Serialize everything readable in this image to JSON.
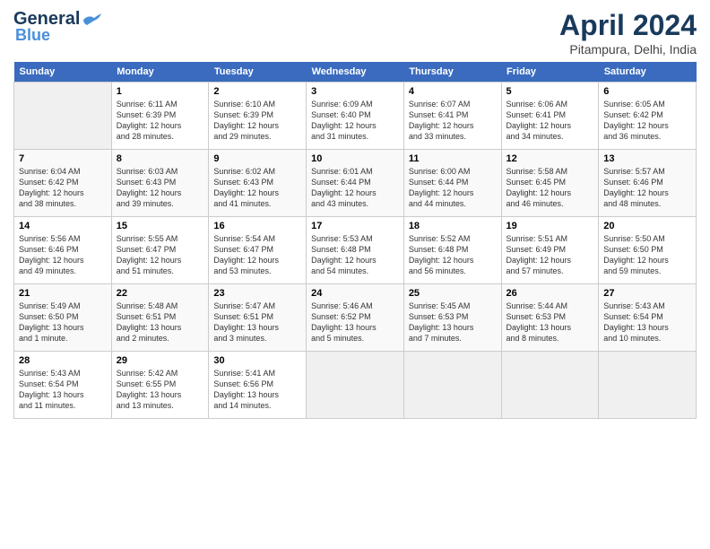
{
  "header": {
    "logo_line1": "General",
    "logo_line2": "Blue",
    "title": "April 2024",
    "subtitle": "Pitampura, Delhi, India"
  },
  "weekdays": [
    "Sunday",
    "Monday",
    "Tuesday",
    "Wednesday",
    "Thursday",
    "Friday",
    "Saturday"
  ],
  "weeks": [
    [
      {
        "day": "",
        "info": ""
      },
      {
        "day": "1",
        "info": "Sunrise: 6:11 AM\nSunset: 6:39 PM\nDaylight: 12 hours\nand 28 minutes."
      },
      {
        "day": "2",
        "info": "Sunrise: 6:10 AM\nSunset: 6:39 PM\nDaylight: 12 hours\nand 29 minutes."
      },
      {
        "day": "3",
        "info": "Sunrise: 6:09 AM\nSunset: 6:40 PM\nDaylight: 12 hours\nand 31 minutes."
      },
      {
        "day": "4",
        "info": "Sunrise: 6:07 AM\nSunset: 6:41 PM\nDaylight: 12 hours\nand 33 minutes."
      },
      {
        "day": "5",
        "info": "Sunrise: 6:06 AM\nSunset: 6:41 PM\nDaylight: 12 hours\nand 34 minutes."
      },
      {
        "day": "6",
        "info": "Sunrise: 6:05 AM\nSunset: 6:42 PM\nDaylight: 12 hours\nand 36 minutes."
      }
    ],
    [
      {
        "day": "7",
        "info": "Sunrise: 6:04 AM\nSunset: 6:42 PM\nDaylight: 12 hours\nand 38 minutes."
      },
      {
        "day": "8",
        "info": "Sunrise: 6:03 AM\nSunset: 6:43 PM\nDaylight: 12 hours\nand 39 minutes."
      },
      {
        "day": "9",
        "info": "Sunrise: 6:02 AM\nSunset: 6:43 PM\nDaylight: 12 hours\nand 41 minutes."
      },
      {
        "day": "10",
        "info": "Sunrise: 6:01 AM\nSunset: 6:44 PM\nDaylight: 12 hours\nand 43 minutes."
      },
      {
        "day": "11",
        "info": "Sunrise: 6:00 AM\nSunset: 6:44 PM\nDaylight: 12 hours\nand 44 minutes."
      },
      {
        "day": "12",
        "info": "Sunrise: 5:58 AM\nSunset: 6:45 PM\nDaylight: 12 hours\nand 46 minutes."
      },
      {
        "day": "13",
        "info": "Sunrise: 5:57 AM\nSunset: 6:46 PM\nDaylight: 12 hours\nand 48 minutes."
      }
    ],
    [
      {
        "day": "14",
        "info": "Sunrise: 5:56 AM\nSunset: 6:46 PM\nDaylight: 12 hours\nand 49 minutes."
      },
      {
        "day": "15",
        "info": "Sunrise: 5:55 AM\nSunset: 6:47 PM\nDaylight: 12 hours\nand 51 minutes."
      },
      {
        "day": "16",
        "info": "Sunrise: 5:54 AM\nSunset: 6:47 PM\nDaylight: 12 hours\nand 53 minutes."
      },
      {
        "day": "17",
        "info": "Sunrise: 5:53 AM\nSunset: 6:48 PM\nDaylight: 12 hours\nand 54 minutes."
      },
      {
        "day": "18",
        "info": "Sunrise: 5:52 AM\nSunset: 6:48 PM\nDaylight: 12 hours\nand 56 minutes."
      },
      {
        "day": "19",
        "info": "Sunrise: 5:51 AM\nSunset: 6:49 PM\nDaylight: 12 hours\nand 57 minutes."
      },
      {
        "day": "20",
        "info": "Sunrise: 5:50 AM\nSunset: 6:50 PM\nDaylight: 12 hours\nand 59 minutes."
      }
    ],
    [
      {
        "day": "21",
        "info": "Sunrise: 5:49 AM\nSunset: 6:50 PM\nDaylight: 13 hours\nand 1 minute."
      },
      {
        "day": "22",
        "info": "Sunrise: 5:48 AM\nSunset: 6:51 PM\nDaylight: 13 hours\nand 2 minutes."
      },
      {
        "day": "23",
        "info": "Sunrise: 5:47 AM\nSunset: 6:51 PM\nDaylight: 13 hours\nand 3 minutes."
      },
      {
        "day": "24",
        "info": "Sunrise: 5:46 AM\nSunset: 6:52 PM\nDaylight: 13 hours\nand 5 minutes."
      },
      {
        "day": "25",
        "info": "Sunrise: 5:45 AM\nSunset: 6:53 PM\nDaylight: 13 hours\nand 7 minutes."
      },
      {
        "day": "26",
        "info": "Sunrise: 5:44 AM\nSunset: 6:53 PM\nDaylight: 13 hours\nand 8 minutes."
      },
      {
        "day": "27",
        "info": "Sunrise: 5:43 AM\nSunset: 6:54 PM\nDaylight: 13 hours\nand 10 minutes."
      }
    ],
    [
      {
        "day": "28",
        "info": "Sunrise: 5:43 AM\nSunset: 6:54 PM\nDaylight: 13 hours\nand 11 minutes."
      },
      {
        "day": "29",
        "info": "Sunrise: 5:42 AM\nSunset: 6:55 PM\nDaylight: 13 hours\nand 13 minutes."
      },
      {
        "day": "30",
        "info": "Sunrise: 5:41 AM\nSunset: 6:56 PM\nDaylight: 13 hours\nand 14 minutes."
      },
      {
        "day": "",
        "info": ""
      },
      {
        "day": "",
        "info": ""
      },
      {
        "day": "",
        "info": ""
      },
      {
        "day": "",
        "info": ""
      }
    ]
  ]
}
